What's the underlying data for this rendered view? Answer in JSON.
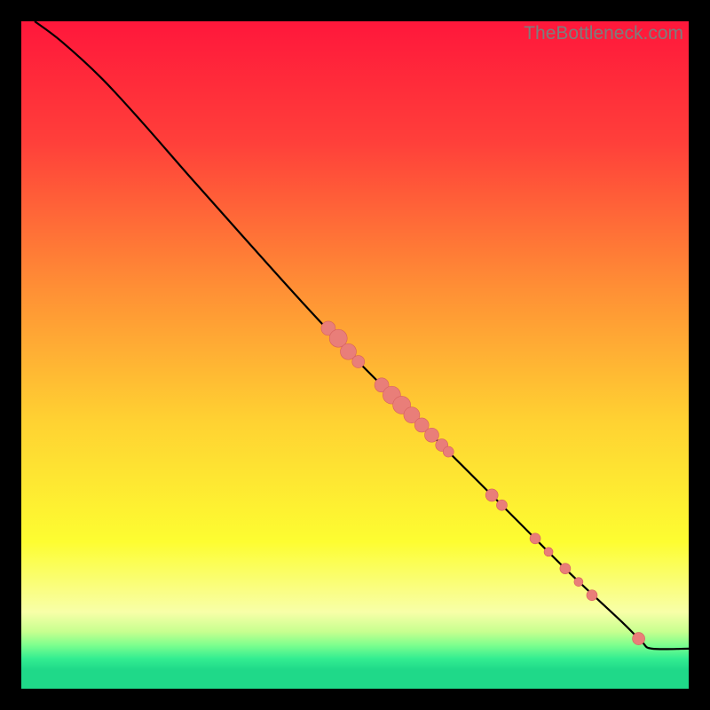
{
  "watermark": "TheBottleneck.com",
  "chart_data": {
    "type": "line",
    "title": "",
    "xlabel": "",
    "ylabel": "",
    "xlim": [
      0,
      100
    ],
    "ylim": [
      0,
      100
    ],
    "background_gradient": {
      "stops": [
        {
          "offset": 0.0,
          "color": "#ff173b"
        },
        {
          "offset": 0.18,
          "color": "#ff3f3a"
        },
        {
          "offset": 0.4,
          "color": "#ff8f35"
        },
        {
          "offset": 0.6,
          "color": "#ffd232"
        },
        {
          "offset": 0.78,
          "color": "#fdfd31"
        },
        {
          "offset": 0.885,
          "color": "#f8ffa8"
        },
        {
          "offset": 0.915,
          "color": "#c6ff8f"
        },
        {
          "offset": 0.935,
          "color": "#7cff8e"
        },
        {
          "offset": 0.955,
          "color": "#33ed91"
        },
        {
          "offset": 0.972,
          "color": "#1fd989"
        },
        {
          "offset": 1.0,
          "color": "#1fd989"
        }
      ]
    },
    "curve": {
      "comment": "Monotone decreasing curve; y expressed as % of plot height from top, x likewise.",
      "points": [
        {
          "x": 2.0,
          "y": 0.0
        },
        {
          "x": 6.0,
          "y": 3.0
        },
        {
          "x": 12.0,
          "y": 8.5
        },
        {
          "x": 18.0,
          "y": 15.0
        },
        {
          "x": 25.0,
          "y": 23.0
        },
        {
          "x": 33.0,
          "y": 32.0
        },
        {
          "x": 42.0,
          "y": 42.0
        },
        {
          "x": 50.0,
          "y": 50.5
        },
        {
          "x": 58.0,
          "y": 58.5
        },
        {
          "x": 66.0,
          "y": 66.5
        },
        {
          "x": 74.0,
          "y": 74.5
        },
        {
          "x": 82.0,
          "y": 82.5
        },
        {
          "x": 90.0,
          "y": 90.0
        },
        {
          "x": 93.0,
          "y": 93.0
        },
        {
          "x": 94.5,
          "y": 94.0
        },
        {
          "x": 100.0,
          "y": 94.0
        }
      ]
    },
    "markers": {
      "color": "#e97e79",
      "stroke": "#d6605e",
      "points": [
        {
          "x": 46.0,
          "y": 46.0,
          "r": 8
        },
        {
          "x": 47.5,
          "y": 47.5,
          "r": 10
        },
        {
          "x": 49.0,
          "y": 49.5,
          "r": 9
        },
        {
          "x": 50.5,
          "y": 51.0,
          "r": 7
        },
        {
          "x": 54.0,
          "y": 54.5,
          "r": 8
        },
        {
          "x": 55.5,
          "y": 56.0,
          "r": 10
        },
        {
          "x": 57.0,
          "y": 57.5,
          "r": 10
        },
        {
          "x": 58.5,
          "y": 59.0,
          "r": 9
        },
        {
          "x": 60.0,
          "y": 60.5,
          "r": 8
        },
        {
          "x": 61.5,
          "y": 62.0,
          "r": 8
        },
        {
          "x": 63.0,
          "y": 63.5,
          "r": 7
        },
        {
          "x": 64.0,
          "y": 64.5,
          "r": 6
        },
        {
          "x": 70.5,
          "y": 71.0,
          "r": 7
        },
        {
          "x": 72.0,
          "y": 72.5,
          "r": 6
        },
        {
          "x": 77.0,
          "y": 77.5,
          "r": 6
        },
        {
          "x": 79.0,
          "y": 79.5,
          "r": 5
        },
        {
          "x": 81.5,
          "y": 82.0,
          "r": 6
        },
        {
          "x": 83.5,
          "y": 84.0,
          "r": 5
        },
        {
          "x": 85.5,
          "y": 86.0,
          "r": 6
        },
        {
          "x": 92.5,
          "y": 92.5,
          "r": 7
        }
      ]
    }
  }
}
